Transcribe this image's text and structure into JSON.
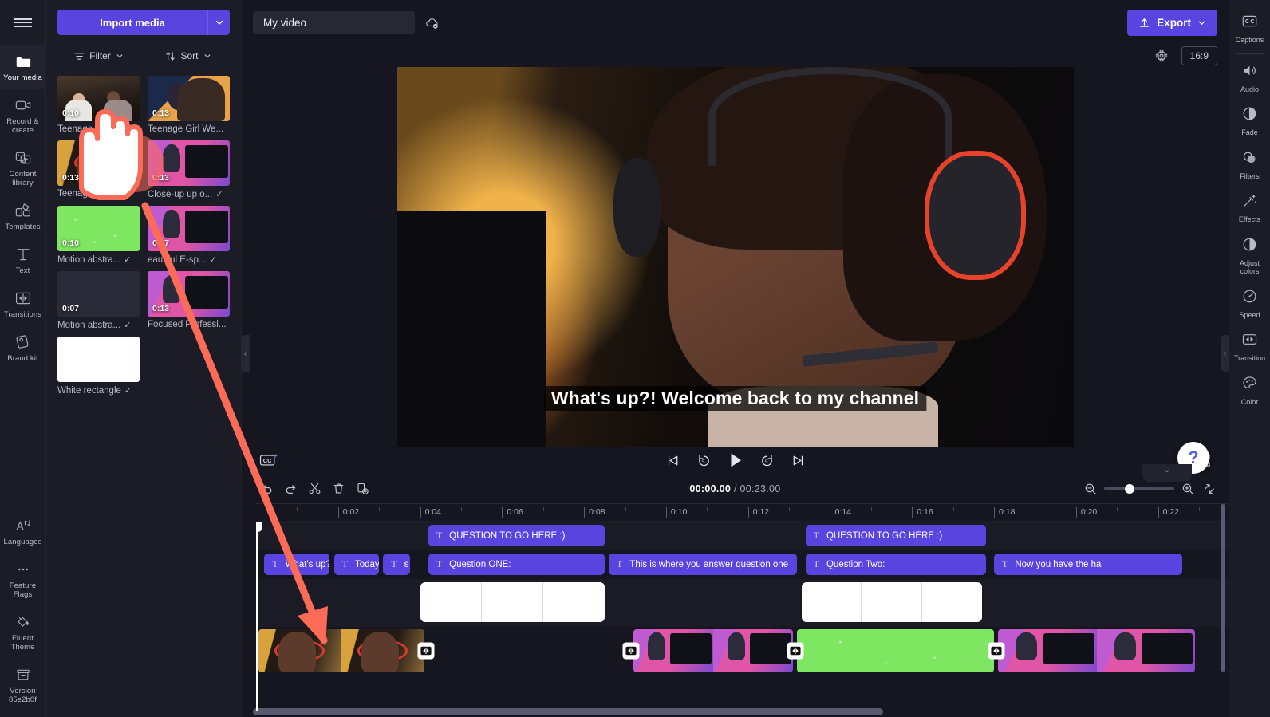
{
  "left_rail": {
    "menu_label": "menu",
    "items": [
      {
        "label": "Your media",
        "icon": "folder-icon",
        "active": true
      },
      {
        "label": "Record & create",
        "icon": "video-camera-icon",
        "active": false
      },
      {
        "label": "Content library",
        "icon": "content-library-icon",
        "active": false
      },
      {
        "label": "Templates",
        "icon": "templates-icon",
        "active": false
      },
      {
        "label": "Text",
        "icon": "text-icon",
        "active": false
      },
      {
        "label": "Transitions",
        "icon": "transitions-icon",
        "active": false
      },
      {
        "label": "Brand kit",
        "icon": "brand-kit-icon",
        "active": false
      }
    ],
    "bottom_items": [
      {
        "label": "Languages",
        "icon": "languages-icon"
      },
      {
        "label": "Feature Flags",
        "icon": "ellipsis-icon"
      },
      {
        "label": "Fluent Theme",
        "icon": "paint-bucket-icon"
      },
      {
        "label": "Version 85e2b0f",
        "icon": "archive-box-icon"
      }
    ]
  },
  "media_panel": {
    "import_label": "Import media",
    "import_caret_icon": "chevron-down-icon",
    "filter_label": "Filter",
    "sort_label": "Sort",
    "collapse_icon": "chevron-left-icon",
    "items": [
      {
        "name": "Teenage Girl Bea...",
        "duration": "0:10",
        "art": "sc1",
        "checked": false
      },
      {
        "name": "Teenage Girl We...",
        "duration": "0:13",
        "art": "sc2",
        "checked": false
      },
      {
        "name": "Teenage Girl ...",
        "duration": "0:13",
        "art": "sc3",
        "checked": false
      },
      {
        "name": "Close-up up o...",
        "duration": "0:13",
        "art": "sc4",
        "checked": true
      },
      {
        "name": "Motion abstra...",
        "duration": "0:10",
        "art": "sc-green",
        "checked": true
      },
      {
        "name": "eautiful E-sp...",
        "duration": "0:17",
        "art": "sc4",
        "checked": true
      },
      {
        "name": "Motion abstra...",
        "duration": "0:07",
        "art": "sc-pink",
        "checked": true
      },
      {
        "name": "Focused Professi...",
        "duration": "0:13",
        "art": "sc4",
        "checked": false
      },
      {
        "name": "White rectangle",
        "duration": "",
        "art": "sc-white",
        "checked": true
      }
    ]
  },
  "topbar": {
    "project_name": "My video",
    "cloud_icon": "cloud-saved-icon",
    "export_label": "Export",
    "export_icon": "upload-icon",
    "export_caret_icon": "chevron-down-icon"
  },
  "stage": {
    "chip_icon": "chip-icon",
    "aspect_ratio": "16:9",
    "subtitle_text": "What's up?! Welcome back to my channel",
    "help_label": "?",
    "collapse_icon": "chevron-down-icon",
    "controls": {
      "captions_icon": "cc-sparkle-icon",
      "skip_back_icon": "skip-to-start-icon",
      "back_5_icon": "rewind-5-icon",
      "play_icon": "play-icon",
      "forward_5_icon": "forward-5-icon",
      "skip_forward_icon": "skip-to-end-icon",
      "fullscreen_icon": "fullscreen-icon"
    }
  },
  "timeline": {
    "tools": [
      {
        "name": "undo",
        "icon": "undo-icon"
      },
      {
        "name": "redo",
        "icon": "redo-icon"
      },
      {
        "name": "split",
        "icon": "scissors-icon"
      },
      {
        "name": "delete",
        "icon": "trash-icon"
      },
      {
        "name": "duplicate",
        "icon": "duplicate-icon"
      }
    ],
    "current_time": "00:00.00",
    "total_time": "00:23.00",
    "time_separator": " / ",
    "zoom_out_icon": "zoom-out-icon",
    "zoom_in_icon": "zoom-in-icon",
    "fit_icon": "fit-to-screen-icon",
    "zoom_value": 30,
    "ruler_ticks": [
      "0:02",
      "0:04",
      "0:06",
      "0:08",
      "0:10",
      "0:12",
      "0:14",
      "0:16",
      "0:18",
      "0:20",
      "0:22"
    ],
    "ruler_start_sec": 0,
    "ruler_end_sec": 23,
    "playhead_time": "00:00.00",
    "track_title_clips": [
      {
        "label": "QUESTION TO GO HERE :)",
        "start": 4.2,
        "end": 8.5,
        "icon": "text-clip-icon"
      },
      {
        "label": "QUESTION TO GO HERE :)",
        "start": 13.4,
        "end": 17.8,
        "icon": "text-clip-icon"
      }
    ],
    "track_caption_clips": [
      {
        "label": "What's up?",
        "start": 0.2,
        "end": 1.8,
        "icon": "text-clip-icon"
      },
      {
        "label": "Today, w",
        "start": 1.9,
        "end": 3.0,
        "icon": "text-clip-icon"
      },
      {
        "label": "s",
        "start": 3.1,
        "end": 3.75,
        "icon": "text-clip-icon"
      },
      {
        "label": "Question ONE:",
        "start": 4.2,
        "end": 8.5,
        "icon": "text-clip-icon"
      },
      {
        "label": "This is where you answer question one",
        "start": 8.6,
        "end": 13.2,
        "icon": "text-clip-icon"
      },
      {
        "label": "Question Two:",
        "start": 13.4,
        "end": 17.8,
        "icon": "text-clip-icon"
      },
      {
        "label": "Now you have the ha",
        "start": 18.0,
        "end": 22.6,
        "icon": "text-clip-icon"
      }
    ],
    "track_overlay_clips": [
      {
        "name": "White rectangle",
        "start": 4.0,
        "end": 8.5,
        "segments": 3
      },
      {
        "name": "White rectangle",
        "start": 13.3,
        "end": 17.7,
        "segments": 3
      }
    ],
    "track_video_clips": [
      {
        "name": "Teenage Girl",
        "art": "sc3",
        "start": 0.05,
        "end": 4.1,
        "frames": 2
      },
      {
        "name": "Motion abstract pink",
        "art": "sc-pink",
        "start": 4.2,
        "end": 9.1,
        "frames": 1
      },
      {
        "name": "Close-up e-sports",
        "art": "sc4",
        "start": 9.2,
        "end": 13.1,
        "frames": 2
      },
      {
        "name": "Motion abstract green",
        "art": "sc-green",
        "start": 13.2,
        "end": 18.0,
        "frames": 1
      },
      {
        "name": "Beautiful E-sports",
        "art": "sc4",
        "start": 18.1,
        "end": 22.9,
        "frames": 2
      }
    ],
    "transition_badges": [
      4.15,
      9.15,
      13.15,
      18.05
    ],
    "transition_icon": "transition-icon"
  },
  "right_rail": {
    "items": [
      {
        "label": "Captions",
        "icon": "cc-icon",
        "divider_after": true
      },
      {
        "label": "Audio",
        "icon": "speaker-icon",
        "divider_after": false
      },
      {
        "label": "Fade",
        "icon": "fade-icon",
        "divider_after": false
      },
      {
        "label": "Filters",
        "icon": "filters-icon",
        "divider_after": false
      },
      {
        "label": "Effects",
        "icon": "effects-wand-icon",
        "divider_after": false
      },
      {
        "label": "Adjust colors",
        "icon": "adjust-colors-icon",
        "divider_after": false
      },
      {
        "label": "Speed",
        "icon": "speedometer-icon",
        "divider_after": false
      },
      {
        "label": "Transition",
        "icon": "transition-icon",
        "divider_after": false
      },
      {
        "label": "Color",
        "icon": "palette-icon",
        "divider_after": false
      }
    ],
    "collapse_icon": "chevron-left-icon"
  },
  "annotation": {
    "cursor_icon": "pointing-hand-cursor",
    "arrow_icon": "red-arrow",
    "accent_color": "#FB6B57"
  },
  "colors": {
    "brand_purple": "#5A44E0",
    "panel_bg": "#1B1C26",
    "app_bg": "#15161F",
    "clip_purple": "#5A44E0",
    "green_screen": "#7EE661",
    "pink_motion": "#E8428C"
  }
}
